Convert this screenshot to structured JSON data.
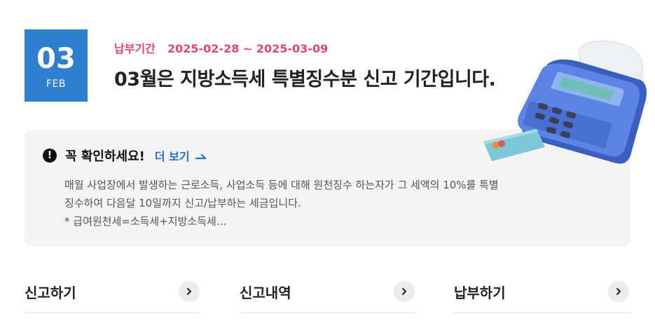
{
  "badge": {
    "day": "03",
    "month": "FEB"
  },
  "period": {
    "label": "납부기간",
    "range": "2025-02-28 ~ 2025-03-09"
  },
  "headline": "03월은 지방소득세 특별징수분 신고 기간입니다.",
  "notice": {
    "icon": "alert-icon",
    "title": "꼭 확인하세요!",
    "more_label": "더 보기",
    "lines": [
      "매월 사업장에서 발생하는 근로소득, 사업소득 등에 대해 원천징수 하는자가 그 세액의 10%를 특별",
      "징수하여 다음달 10일까지 신고/납부하는 세금입니다.",
      "* 급여원천세=소득세+지방소득세…"
    ]
  },
  "menu": [
    {
      "label": "신고하기",
      "icon": "chevron-right-icon"
    },
    {
      "label": "신고내역",
      "icon": "chevron-right-icon"
    },
    {
      "label": "납부하기",
      "icon": "chevron-right-icon"
    }
  ],
  "colors": {
    "badge_blue": "#2f7fd1",
    "period_pink": "#e0457a",
    "link_blue": "#1f6fd6",
    "box_gray": "#f4f4f5"
  }
}
